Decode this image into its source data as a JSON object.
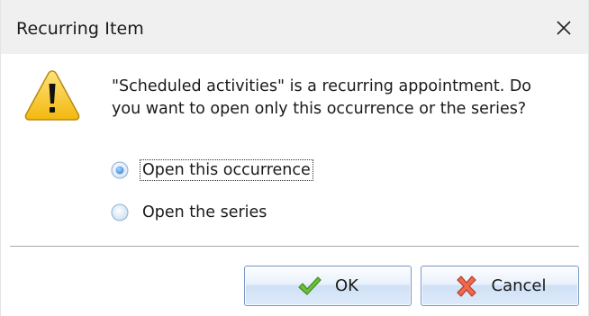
{
  "window": {
    "title": "Recurring Item"
  },
  "icons": {
    "close": "close-icon",
    "warning": "warning-icon",
    "ok": "checkmark-icon",
    "cancel": "x-mark-icon"
  },
  "message": {
    "line1": "\"Scheduled activities\" is a recurring appointment. Do",
    "line2": "you want to open only this occurrence or the series?"
  },
  "options": [
    {
      "label": "Open this occurrence",
      "selected": true
    },
    {
      "label": "Open the series",
      "selected": false
    }
  ],
  "buttons": {
    "ok_label": "OK",
    "cancel_label": "Cancel"
  },
  "colors": {
    "warning_yellow": "#f7c51e",
    "ok_green": "#5fae2e",
    "cancel_red": "#e0533a",
    "button_border": "#7b98c4"
  }
}
